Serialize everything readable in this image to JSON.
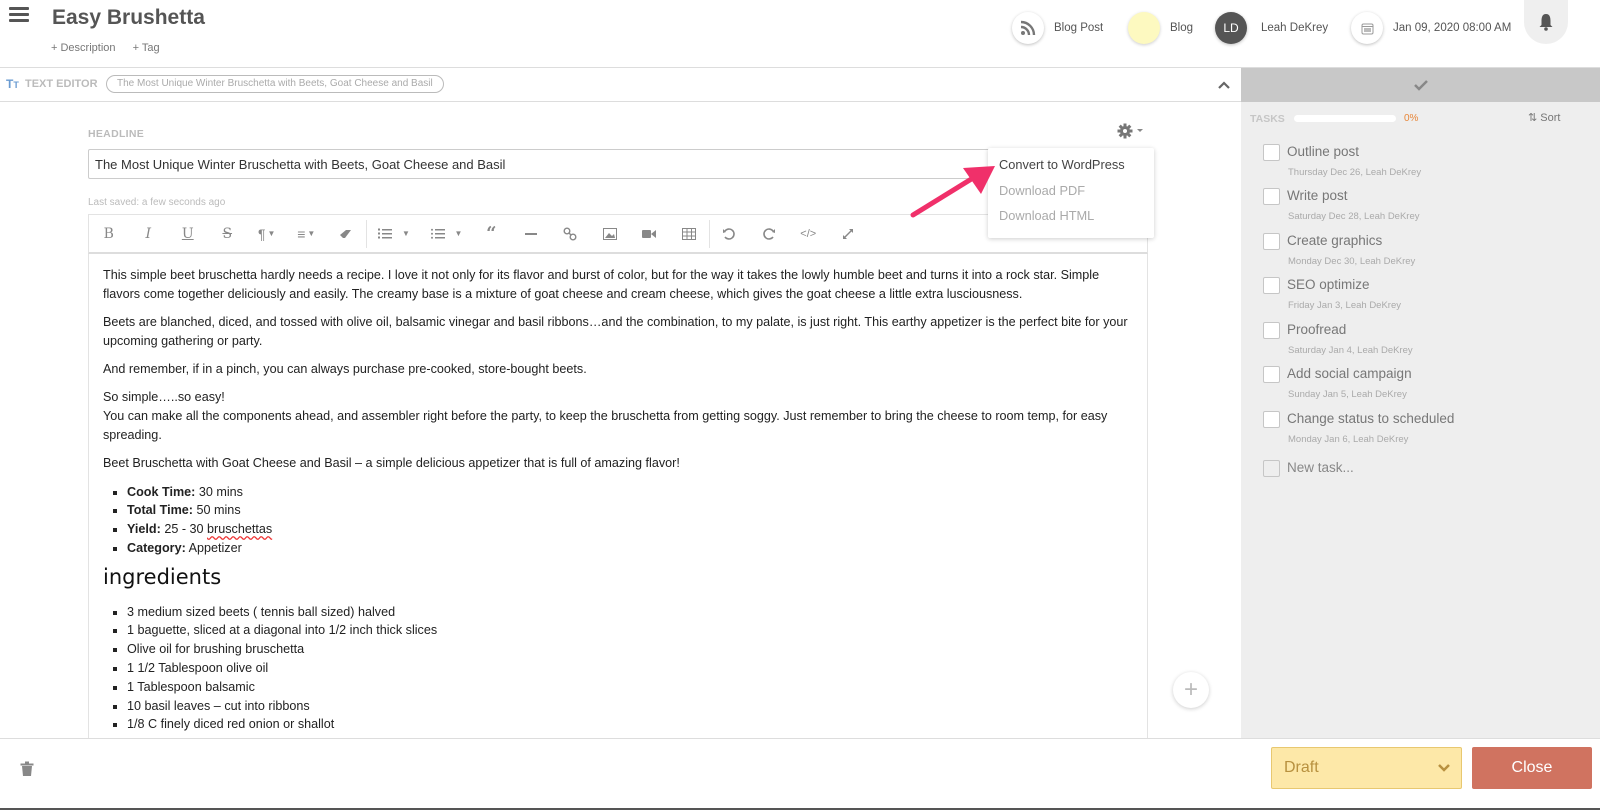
{
  "header": {
    "title": "Easy Brushetta",
    "add_description": "+ Description",
    "add_tag": "+ Tag",
    "content_type": "Blog Post",
    "channel": "Blog",
    "channel_color": "#fdf9c0",
    "owner_initials": "LD",
    "owner_name": "Leah DeKrey",
    "date": "Jan 09, 2020 08:00 AM"
  },
  "text_editor_bar": {
    "label": "TEXT EDITOR",
    "chip": "The Most Unique Winter Bruschetta with Beets, Goat Cheese and Basil"
  },
  "editor": {
    "headline_label": "HEADLINE",
    "headline_value": "The Most Unique Winter Bruschetta with Beets, Goat Cheese and Basil",
    "last_saved": "Last saved: a few seconds ago",
    "toolbar": [
      "bold",
      "italic",
      "underline",
      "strikethrough",
      "paragraph-format",
      "align",
      "clear-formatting",
      "ordered-list",
      "unordered-list",
      "quote",
      "horizontal-rule",
      "link",
      "image",
      "video",
      "table",
      "undo",
      "redo",
      "code-view",
      "fullscreen"
    ],
    "paragraphs": [
      "This simple beet bruschetta hardly needs a recipe. I love it not only for its flavor and burst of color, but for the way it takes the lowly humble beet and turns it into a rock star. Simple flavors come together deliciously and easily.  The creamy base is a mixture of goat cheese and cream cheese, which gives the goat cheese a little extra lusciousness.",
      "Beets are blanched, diced, and tossed with olive oil, balsamic vinegar and basil ribbons…and the combination, to my palate, is just right. This earthy  appetizer is the perfect bite for your upcoming gathering or party.",
      "And remember, if in a pinch, you can always purchase pre-cooked, store-bought beets.",
      "So simple…..so easy!",
      "You can make all the components ahead, and assembler right before the party, to keep the bruschetta from getting soggy.  Just remember to bring the cheese to room temp, for easy spreading.",
      "Beet Bruschetta with Goat Cheese and Basil – a simple delicious appetizer that is full of amazing flavor!"
    ],
    "details": [
      {
        "label": "Cook Time:",
        "value": " 30 mins"
      },
      {
        "label": "Total Time:",
        "value": " 50 mins"
      },
      {
        "label": "Yield:",
        "value": " 25 - 30 ",
        "spell": "bruschettas"
      },
      {
        "label": "Category:",
        "value": " Appetizer"
      }
    ],
    "ingredients_heading": "ingredients",
    "ingredients": [
      "3 medium sized beets ( tennis ball sized) halved",
      "1 baguette, sliced at a diagonal into 1/2 inch thick slices",
      "Olive oil for brushing bruschetta",
      "1 1/2 Tablespoon olive oil",
      "1 Tablespoon balsamic",
      "10 basil leaves – cut into ribbons",
      "1/8 C finely diced red onion or shallot"
    ]
  },
  "settings_menu": {
    "items": [
      "Convert to WordPress",
      "Download PDF",
      "Download HTML"
    ]
  },
  "tasks": {
    "label": "TASKS",
    "progress_percent": 0,
    "progress_text": "0%",
    "progress_color": "#e8873a",
    "sort_label": "Sort",
    "items": [
      {
        "name": "Outline post",
        "meta": "Thursday Dec 26,  Leah DeKrey"
      },
      {
        "name": "Write post",
        "meta": "Saturday Dec 28,  Leah DeKrey"
      },
      {
        "name": "Create graphics",
        "meta": "Monday Dec 30,  Leah DeKrey"
      },
      {
        "name": "SEO optimize",
        "meta": "Friday Jan 3,  Leah DeKrey"
      },
      {
        "name": "Proofread",
        "meta": "Saturday Jan 4,  Leah DeKrey"
      },
      {
        "name": "Add social campaign",
        "meta": "Sunday Jan 5,  Leah DeKrey"
      },
      {
        "name": "Change status to scheduled",
        "meta": "Monday Jan 6,  Leah DeKrey"
      }
    ],
    "new_task_placeholder": "New task..."
  },
  "footer": {
    "status": "Draft",
    "status_color": "#fde8a8",
    "close_label": "Close",
    "close_color": "#d07360"
  }
}
